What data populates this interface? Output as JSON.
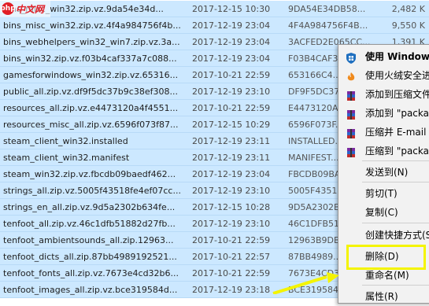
{
  "watermark": {
    "text": "php中文网",
    "logo_text": "php",
    "site_text": "中文网"
  },
  "files": [
    {
      "name": "bins_misc_win32.zip.vz.9da54e34d...",
      "date": "2017-12-15 10:30",
      "type": "9DA54E34DB58...",
      "size": "2,482 K"
    },
    {
      "name": "bins_misc_win32.zip.vz.4f4a984756f4b...",
      "date": "2017-12-19 23:04",
      "type": "4F4A984756F4B...",
      "size": "9,550 K"
    },
    {
      "name": "bins_webhelpers_win32_win7.zip.vz.3a...",
      "date": "2017-12-19 23:04",
      "type": "3ACFED2E065CC...",
      "size": "1,391 K"
    },
    {
      "name": "bins_win32.zip.vz.f03b4caf337a7c088...",
      "date": "2017-12-19 23:04",
      "type": "F03B4CAF337A...",
      "size": ""
    },
    {
      "name": "gamesforwindows_win32.zip.vz.65316...",
      "date": "2017-10-21 22:59",
      "type": "653166C4...",
      "size": ""
    },
    {
      "name": "public_all.zip.vz.df9f5dc37b9c38ef308...",
      "date": "2017-12-19 23:10",
      "type": "DF9F5DC37...",
      "size": ""
    },
    {
      "name": "resources_all.zip.vz.e4473120a4f4551...",
      "date": "2017-10-21 22:59",
      "type": "E4473120A...",
      "size": ""
    },
    {
      "name": "resources_misc_all.zip.vz.6596f073f87...",
      "date": "2017-12-15 10:29",
      "type": "6596F073F...",
      "size": ""
    },
    {
      "name": "steam_client_win32.installed",
      "date": "2017-12-19 23:11",
      "type": "INSTALLED...",
      "size": ""
    },
    {
      "name": "steam_client_win32.manifest",
      "date": "2017-12-19 23:11",
      "type": "MANIFEST...",
      "size": ""
    },
    {
      "name": "steam_win32.zip.vz.fbcdb09baedf462...",
      "date": "2017-12-19 23:04",
      "type": "FBCDB09BA...",
      "size": ""
    },
    {
      "name": "strings_all.zip.vz.5005f43518fe4ef07cc...",
      "date": "2017-12-19 23:10",
      "type": "5005F4351...",
      "size": ""
    },
    {
      "name": "strings_en_all.zip.vz.9d5a2302b634fe...",
      "date": "2017-12-15 10:28",
      "type": "9D5A2302B...",
      "size": ""
    },
    {
      "name": "tenfoot_all.zip.vz.46c1dfb51882d27fb...",
      "date": "2017-12-19 23:10",
      "type": "46C1DFB51...",
      "size": ""
    },
    {
      "name": "tenfoot_ambientsounds_all.zip.12963...",
      "date": "2017-10-21 22:59",
      "type": "12963B9DB...",
      "size": ""
    },
    {
      "name": "tenfoot_dicts_all.zip.87bb4989192521...",
      "date": "2017-10-21 22:57",
      "type": "87BB4989...",
      "size": ""
    },
    {
      "name": "tenfoot_fonts_all.zip.vz.7673e4cd32b6...",
      "date": "2017-10-21 22:59",
      "type": "7673E4CD3...",
      "size": ""
    },
    {
      "name": "tenfoot_images_all.zip.vz.bce319584d...",
      "date": "2017-12-19 23:18",
      "type": "BCE319584...",
      "size": ""
    }
  ],
  "context_menu": {
    "items": [
      {
        "label": "使用 Windows",
        "icon": "windows-defender-shield-icon",
        "bold": true
      },
      {
        "label": "使用火绒安全进",
        "icon": "huorong-security-icon",
        "bold": false
      },
      {
        "label": "添加到压缩文件",
        "icon": "winrar-archive-icon",
        "bold": false
      },
      {
        "label": "添加到 \"packa",
        "icon": "winrar-archive-icon",
        "bold": false
      },
      {
        "label": "压缩并 E-mail",
        "icon": "winrar-archive-icon",
        "bold": false
      },
      {
        "label": "压缩到 \"packa",
        "icon": "winrar-archive-icon",
        "bold": false
      },
      {
        "label": "发送到(N)",
        "icon": "",
        "bold": false
      },
      {
        "label": "剪切(T)",
        "icon": "",
        "bold": false
      },
      {
        "label": "复制(C)",
        "icon": "",
        "bold": false
      },
      {
        "label": "创建快捷方式(S",
        "icon": "",
        "bold": false
      },
      {
        "label": "删除(D)",
        "icon": "",
        "bold": false
      },
      {
        "label": "重命名(M)",
        "icon": "",
        "bold": false
      },
      {
        "label": "属性(R)",
        "icon": "",
        "bold": false
      }
    ]
  },
  "colors": {
    "selection": "#cce8ff",
    "highlight_box": "#f4f400",
    "menu_bg": "#f2f2f2"
  }
}
